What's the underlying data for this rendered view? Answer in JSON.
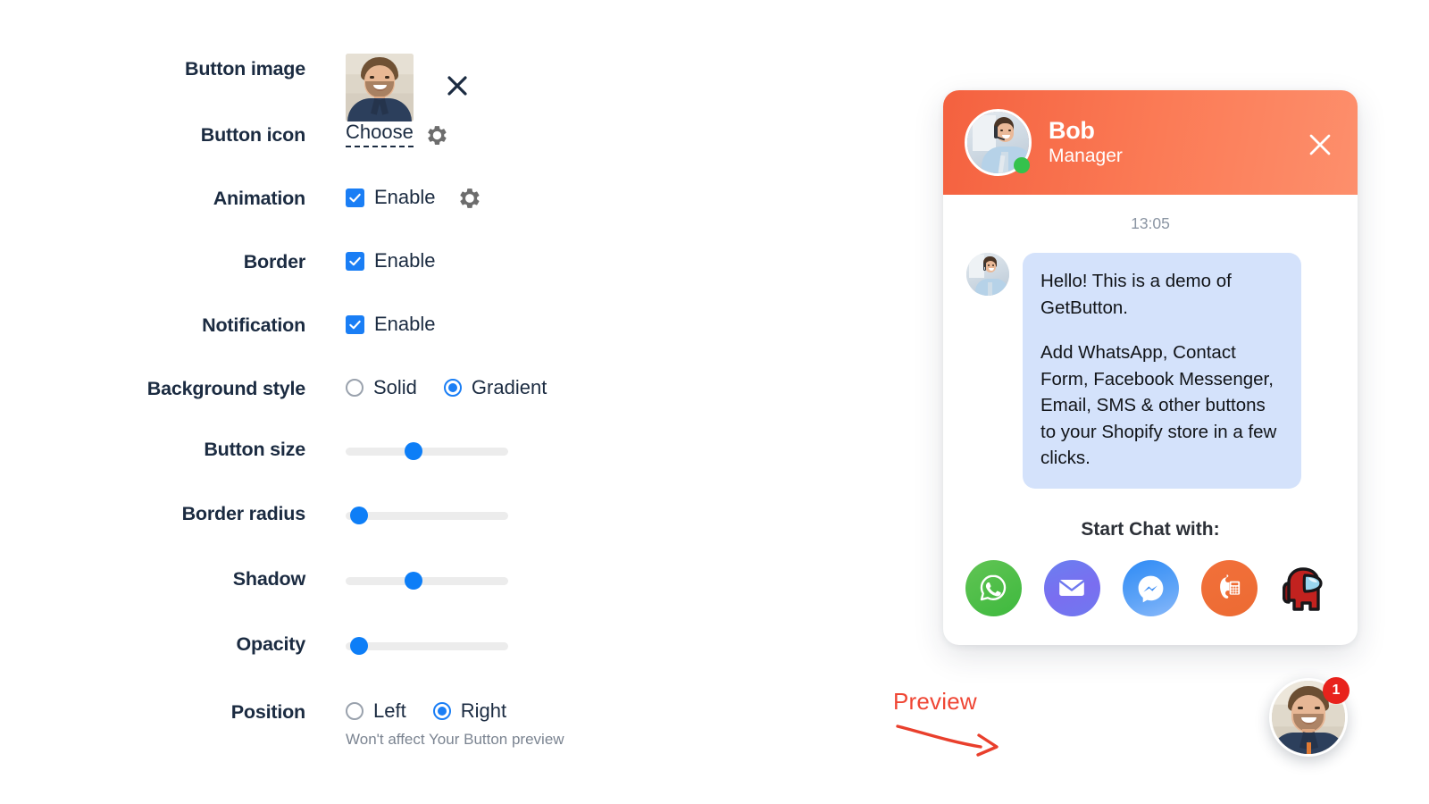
{
  "settings": {
    "rows": [
      {
        "label": "Button image",
        "type": "image"
      },
      {
        "label": "Button icon",
        "type": "choose",
        "choose_label": "Choose"
      },
      {
        "label": "Animation",
        "type": "checkbox",
        "checkbox_label": "Enable",
        "checked": true,
        "has_gear": true
      },
      {
        "label": "Border",
        "type": "checkbox",
        "checkbox_label": "Enable",
        "checked": true,
        "has_gear": false
      },
      {
        "label": "Notification",
        "type": "checkbox",
        "checkbox_label": "Enable",
        "checked": true,
        "has_gear": false
      },
      {
        "label": "Background style",
        "type": "radio",
        "options": [
          "Solid",
          "Gradient"
        ],
        "selected": "Gradient"
      },
      {
        "label": "Button size",
        "type": "slider",
        "value_percent": 42
      },
      {
        "label": "Border radius",
        "type": "slider",
        "value_percent": 8
      },
      {
        "label": "Shadow",
        "type": "slider",
        "value_percent": 42
      },
      {
        "label": "Opacity",
        "type": "slider",
        "value_percent": 8
      },
      {
        "label": "Position",
        "type": "radio",
        "options": [
          "Left",
          "Right"
        ],
        "selected": "Right",
        "hint": "Won't affect Your Button preview"
      }
    ],
    "accent_color": "#0d7ef7",
    "label_color": "#1b2b41",
    "hint_color": "#7b8491"
  },
  "widget": {
    "agent_name": "Bob",
    "agent_role": "Manager",
    "online": true,
    "close_icon": "close-icon",
    "timestamp": "13:05",
    "message_paragraphs": [
      "Hello! This is a demo of GetButton.",
      "Add WhatsApp, Contact Form, Facebook Messenger, Email, SMS & other buttons to your Shopify store in a few clicks."
    ],
    "start_chat_label": "Start Chat with:",
    "channels": [
      {
        "name": "WhatsApp",
        "icon": "whatsapp-icon",
        "color": "#4fbe4a"
      },
      {
        "name": "Email",
        "icon": "email-icon",
        "color": "#6f79ef"
      },
      {
        "name": "Facebook Messenger",
        "icon": "messenger-icon",
        "color": "#3b8df5"
      },
      {
        "name": "Phone",
        "icon": "phone-icon",
        "color": "#ef6d34"
      },
      {
        "name": "Among Us",
        "icon": "among-us-icon",
        "color": "#c2221f"
      }
    ],
    "header_gradient_from": "#f4613f",
    "header_gradient_to": "#fd8f6c",
    "bubble_color": "#d4e2fb"
  },
  "annotation": {
    "preview_label": "Preview",
    "color": "#ef4634"
  },
  "launcher": {
    "badge_count": "1",
    "badge_color": "#e8221c"
  }
}
